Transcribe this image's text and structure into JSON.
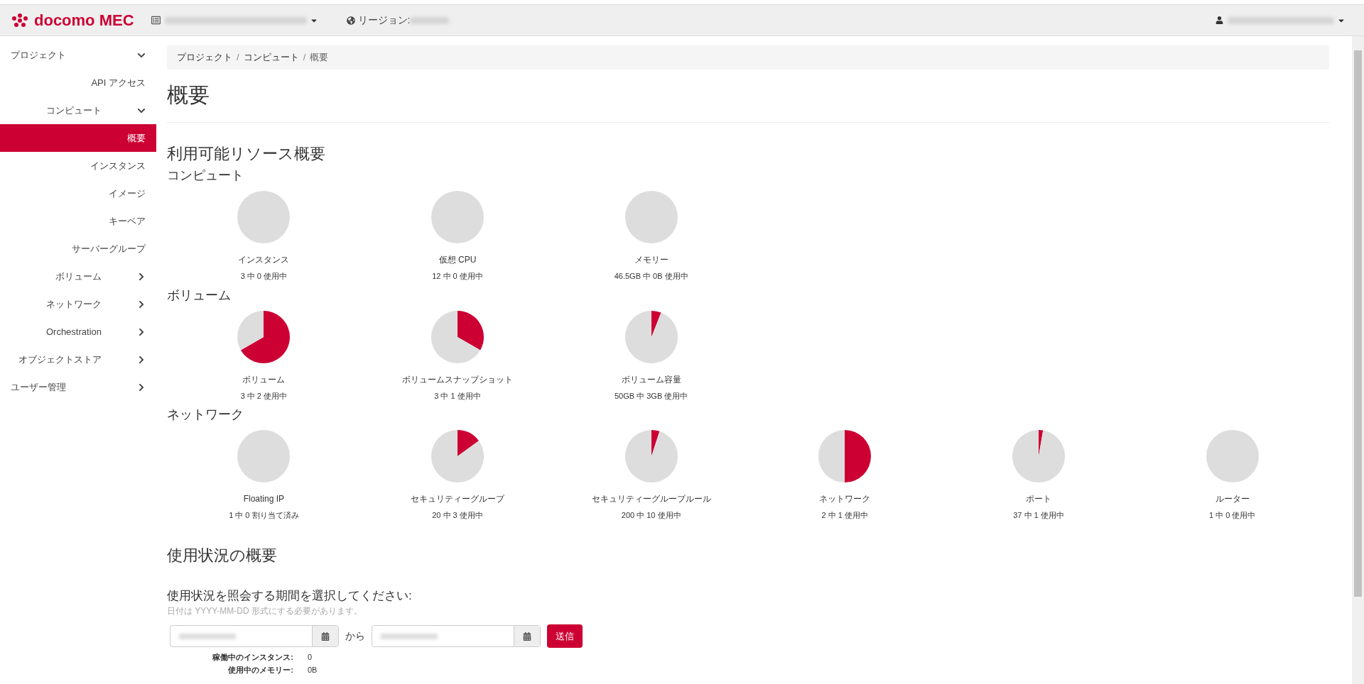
{
  "header": {
    "logo": "docomo MEC",
    "region_label": "リージョン:"
  },
  "sidebar": {
    "items": [
      {
        "label": "プロジェクト",
        "kind": "top",
        "expanded": true,
        "selected": false
      },
      {
        "label": "API アクセス",
        "kind": "leaf",
        "selected": false
      },
      {
        "label": "コンピュート",
        "kind": "group",
        "expanded": true,
        "selected": false
      },
      {
        "label": "概要",
        "kind": "leaf",
        "selected": true
      },
      {
        "label": "インスタンス",
        "kind": "leaf",
        "selected": false
      },
      {
        "label": "イメージ",
        "kind": "leaf",
        "selected": false
      },
      {
        "label": "キーペア",
        "kind": "leaf",
        "selected": false
      },
      {
        "label": "サーバーグループ",
        "kind": "leaf",
        "selected": false
      },
      {
        "label": "ボリューム",
        "kind": "group",
        "expanded": false,
        "selected": false
      },
      {
        "label": "ネットワーク",
        "kind": "group",
        "expanded": false,
        "selected": false
      },
      {
        "label": "Orchestration",
        "kind": "group",
        "expanded": false,
        "selected": false
      },
      {
        "label": "オブジェクトストア",
        "kind": "group",
        "expanded": false,
        "selected": false
      },
      {
        "label": "ユーザー管理",
        "kind": "top",
        "expanded": false,
        "selected": false
      }
    ]
  },
  "breadcrumb": {
    "separator": "/",
    "items": [
      "プロジェクト",
      "コンピュート",
      "概要"
    ]
  },
  "page_title": "概要",
  "resources": {
    "title": "利用可能リソース概要",
    "groups": [
      {
        "title": "コンピュート",
        "pies": [
          {
            "label": "インスタンス",
            "usage": "3 中 0 使用中",
            "chart_data": {
              "type": "pie",
              "values": [
                0,
                100
              ]
            }
          },
          {
            "label": "仮想 CPU",
            "usage": "12 中 0 使用中",
            "chart_data": {
              "type": "pie",
              "values": [
                0,
                100
              ]
            }
          },
          {
            "label": "メモリー",
            "usage": "46.5GB 中 0B 使用中",
            "chart_data": {
              "type": "pie",
              "values": [
                0,
                100
              ]
            }
          }
        ]
      },
      {
        "title": "ボリューム",
        "pies": [
          {
            "label": "ボリューム",
            "usage": "3 中 2 使用中",
            "chart_data": {
              "type": "pie",
              "values": [
                66.7,
                33.3
              ]
            }
          },
          {
            "label": "ボリュームスナップショット",
            "usage": "3 中 1 使用中",
            "chart_data": {
              "type": "pie",
              "values": [
                33.3,
                66.7
              ]
            }
          },
          {
            "label": "ボリューム容量",
            "usage": "50GB 中 3GB 使用中",
            "chart_data": {
              "type": "pie",
              "values": [
                6,
                94
              ]
            }
          }
        ]
      },
      {
        "title": "ネットワーク",
        "pies": [
          {
            "label": "Floating IP",
            "usage": "1 中 0 割り当て済み",
            "chart_data": {
              "type": "pie",
              "values": [
                0,
                100
              ]
            }
          },
          {
            "label": "セキュリティーグループ",
            "usage": "20 中 3 使用中",
            "chart_data": {
              "type": "pie",
              "values": [
                15,
                85
              ]
            }
          },
          {
            "label": "セキュリティーグループルール",
            "usage": "200 中 10 使用中",
            "chart_data": {
              "type": "pie",
              "values": [
                5,
                95
              ]
            }
          },
          {
            "label": "ネットワーク",
            "usage": "2 中 1 使用中",
            "chart_data": {
              "type": "pie",
              "values": [
                50,
                50
              ]
            }
          },
          {
            "label": "ポート",
            "usage": "37 中 1 使用中",
            "chart_data": {
              "type": "pie",
              "values": [
                2.7,
                97.3
              ]
            }
          },
          {
            "label": "ルーター",
            "usage": "1 中 0 使用中",
            "chart_data": {
              "type": "pie",
              "values": [
                0,
                100
              ]
            }
          }
        ]
      }
    ]
  },
  "usage": {
    "title": "使用状況の概要",
    "prompt": "使用状況を照会する期間を選択してください:",
    "hint": "日付は YYYY-MM-DD 形式にする必要があります。",
    "between": "から",
    "submit": "送信",
    "stats": [
      {
        "label": "稼働中のインスタンス:",
        "value": "0"
      },
      {
        "label": "使用中のメモリー:",
        "value": "0B"
      }
    ]
  }
}
